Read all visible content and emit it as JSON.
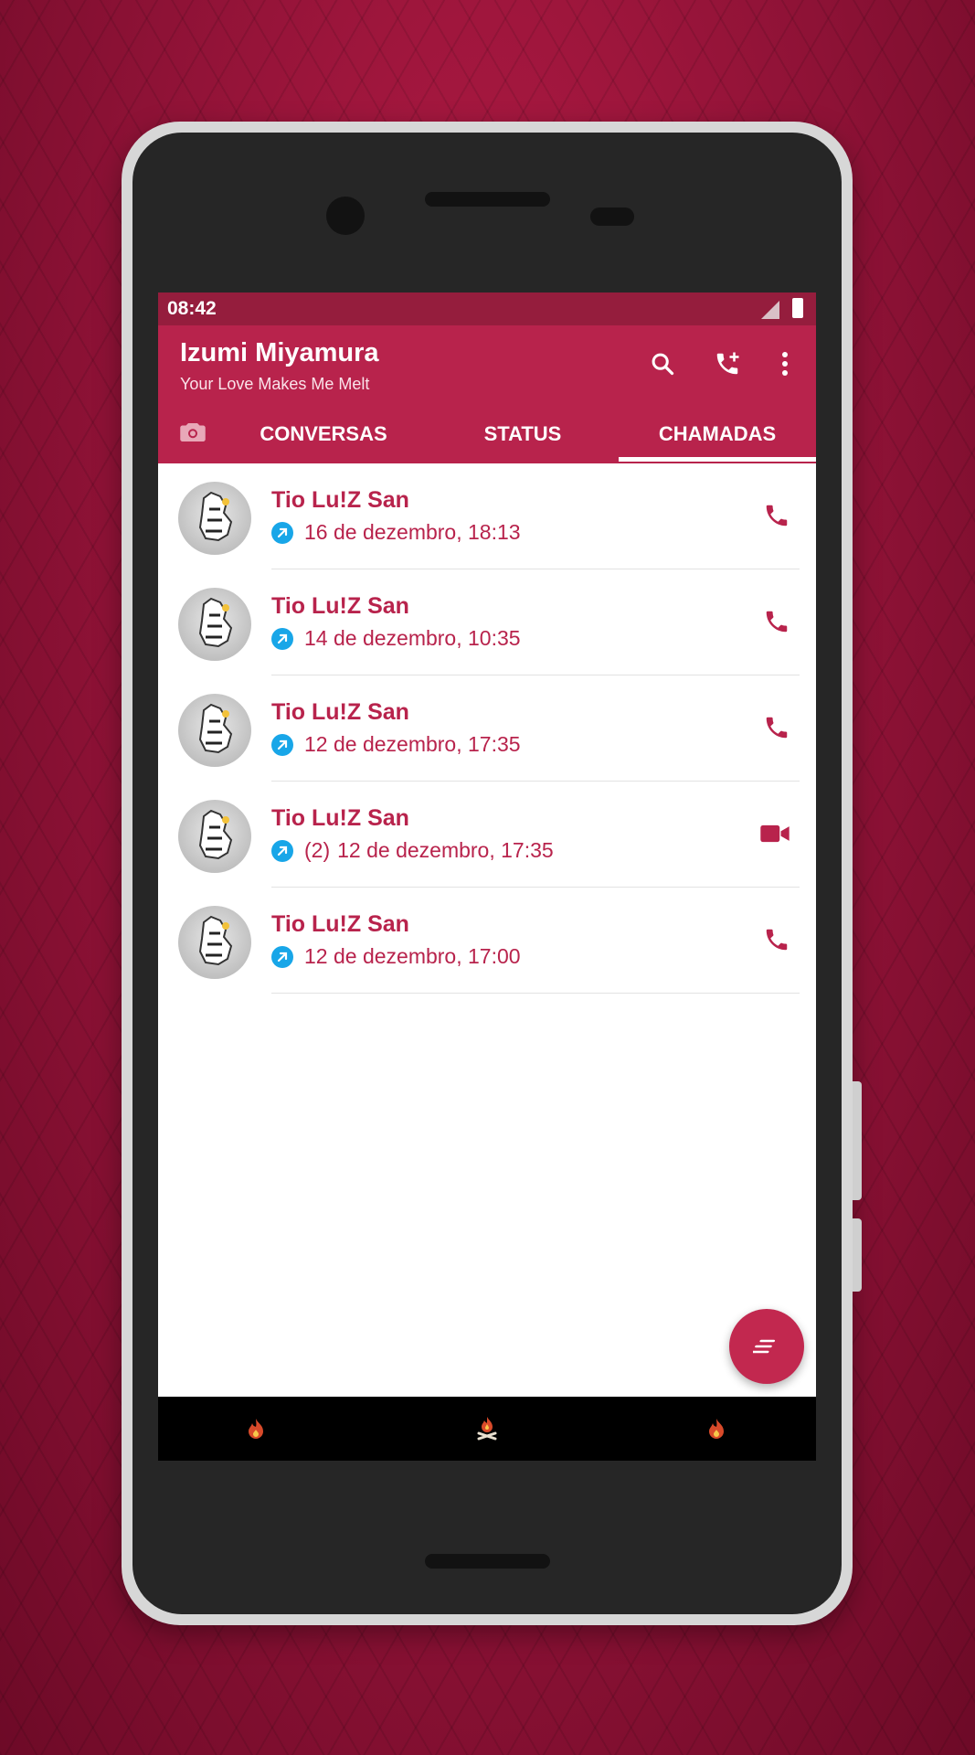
{
  "status_bar": {
    "time": "08:42"
  },
  "app_bar": {
    "title": "Izumi Miyamura",
    "subtitle": "Your Love Makes Me Melt",
    "icons": [
      "search-icon",
      "add-call-icon",
      "more-vert-icon"
    ]
  },
  "tabs": [
    {
      "label": "CONVERSAS"
    },
    {
      "label": "STATUS"
    },
    {
      "label": "CHAMADAS",
      "selected": true
    }
  ],
  "calls": [
    {
      "name": "Tio Lu!Z San",
      "count": "",
      "datetime": "16 de dezembro, 18:13",
      "type": "voice"
    },
    {
      "name": "Tio Lu!Z San",
      "count": "",
      "datetime": "14 de dezembro, 10:35",
      "type": "voice"
    },
    {
      "name": "Tio Lu!Z San",
      "count": "",
      "datetime": "12 de dezembro, 17:35",
      "type": "voice"
    },
    {
      "name": "Tio Lu!Z San",
      "count": "(2)",
      "datetime": "12 de dezembro, 17:35",
      "type": "video"
    },
    {
      "name": "Tio Lu!Z San",
      "count": "",
      "datetime": "12 de dezembro, 17:00",
      "type": "voice"
    }
  ],
  "colors": {
    "primary": "#b8234c",
    "status_bar": "#951d3d",
    "outgoing_badge": "#18a6e8"
  }
}
